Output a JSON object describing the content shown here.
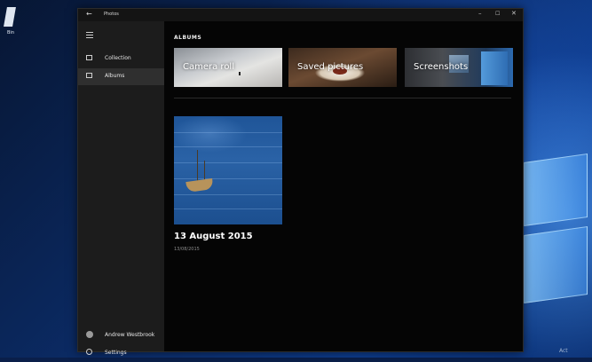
{
  "desktop": {
    "icon_label": "Bin",
    "corner_text": "Act"
  },
  "window": {
    "title": "Photos",
    "controls": {
      "minimize": "–",
      "maximize": "☐",
      "close": "✕"
    },
    "back": "←"
  },
  "sidebar": {
    "items": [
      {
        "label": "Collection",
        "icon": "collection-icon"
      },
      {
        "label": "Albums",
        "icon": "albums-icon"
      }
    ],
    "user": {
      "label": "Andrew Westbrook"
    },
    "settings": {
      "label": "Settings"
    }
  },
  "main": {
    "heading": "ALBUMS",
    "tiles": [
      {
        "label": "Camera roll"
      },
      {
        "label": "Saved pictures"
      },
      {
        "label": "Screenshots"
      }
    ],
    "album": {
      "title": "13 August 2015",
      "date": "13/08/2015"
    }
  }
}
